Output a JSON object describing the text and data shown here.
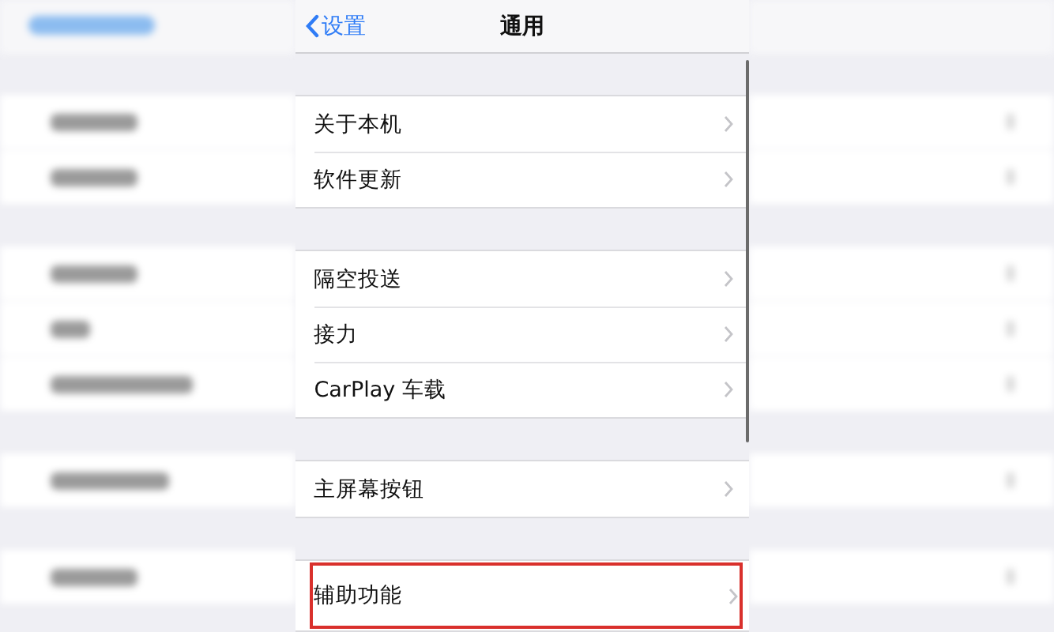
{
  "nav": {
    "back": "设置",
    "title": "通用"
  },
  "groups": [
    {
      "items": [
        {
          "label": "关于本机",
          "highlighted": false
        },
        {
          "label": "软件更新",
          "highlighted": false
        }
      ]
    },
    {
      "items": [
        {
          "label": "隔空投送",
          "highlighted": false
        },
        {
          "label": "接力",
          "highlighted": false
        },
        {
          "label": "CarPlay 车载",
          "highlighted": false
        }
      ]
    },
    {
      "items": [
        {
          "label": "主屏幕按钮",
          "highlighted": false
        }
      ]
    },
    {
      "items": [
        {
          "label": "辅助功能",
          "highlighted": true
        }
      ]
    }
  ]
}
